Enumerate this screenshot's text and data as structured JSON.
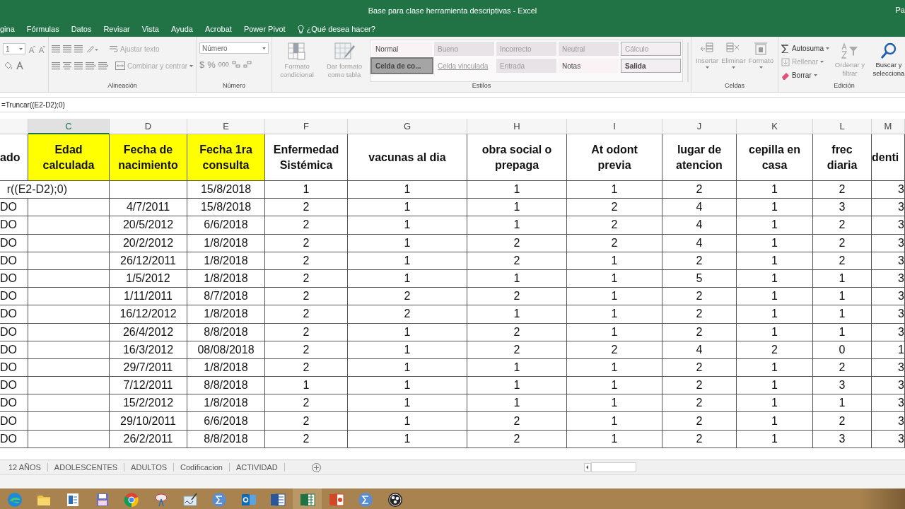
{
  "window": {
    "title": "Base para clase herramienta descriptivas  -  Excel",
    "account": "Pa"
  },
  "menu_tabs": [
    {
      "label": "gina",
      "kind": "tab",
      "selected": false
    },
    {
      "label": "Fórmulas",
      "kind": "tab",
      "selected": false
    },
    {
      "label": "Datos",
      "kind": "tab",
      "selected": false
    },
    {
      "label": "Revisar",
      "kind": "tab",
      "selected": false
    },
    {
      "label": "Vista",
      "kind": "tab",
      "selected": false
    },
    {
      "label": "Ayuda",
      "kind": "tab",
      "selected": false
    },
    {
      "label": "Acrobat",
      "kind": "tab",
      "selected": false
    },
    {
      "label": "Power Pivot",
      "kind": "tab",
      "selected": false
    },
    {
      "label": "¿Qué desea hacer?",
      "kind": "tell",
      "selected": false
    }
  ],
  "ribbon": {
    "font": {
      "size": "1"
    },
    "alignment": {
      "label": "Alineación",
      "wrap": {
        "label": "Ajustar texto",
        "disabled": true
      },
      "merge": {
        "label": "Combinar y centrar",
        "disabled": true
      }
    },
    "number": {
      "label": "Número",
      "format": "Número",
      "symbols": [
        "$",
        "%",
        "000"
      ]
    },
    "styles": {
      "label": "Estilos",
      "conditional": "Formato condicional",
      "table": "Dar formato como tabla",
      "gallery": [
        {
          "label": "Normal",
          "kind": "normal",
          "selected": false,
          "disabled": false
        },
        {
          "label": "Bueno",
          "kind": "plain",
          "selected": false,
          "disabled": true
        },
        {
          "label": "Incorrecto",
          "kind": "plain",
          "selected": false,
          "disabled": true
        },
        {
          "label": "Neutral",
          "kind": "plain",
          "selected": false,
          "disabled": true
        },
        {
          "label": "Cálculo",
          "kind": "boxed",
          "selected": false,
          "disabled": true
        },
        {
          "label": "Celda de co...",
          "kind": "check",
          "selected": true,
          "disabled": false
        },
        {
          "label": "Celda vinculada",
          "kind": "linked",
          "selected": false,
          "disabled": true
        },
        {
          "label": "Entrada",
          "kind": "plain",
          "selected": false,
          "disabled": true
        },
        {
          "label": "Notas",
          "kind": "normal",
          "selected": false,
          "disabled": false
        },
        {
          "label": "Salida",
          "kind": "boxed",
          "selected": false,
          "disabled": false
        }
      ]
    },
    "cells": {
      "label": "Celdas",
      "commands": [
        {
          "label": "Insertar",
          "kind": "insert",
          "disabled": true
        },
        {
          "label": "Eliminar",
          "kind": "delete",
          "disabled": true
        },
        {
          "label": "Formato",
          "kind": "format",
          "disabled": true
        }
      ]
    },
    "editing": {
      "label": "Edición",
      "commands": [
        {
          "label": "Autosuma",
          "kind": "sum",
          "disabled": false
        },
        {
          "label": "Rellenar",
          "kind": "fill",
          "disabled": true
        },
        {
          "label": "Borrar",
          "kind": "clear",
          "disabled": false
        }
      ],
      "sort": {
        "label": "Ordenar y filtrar",
        "disabled": true
      },
      "find": {
        "label": "Buscar y selecciona",
        "disabled": false
      }
    }
  },
  "formula_bar": {
    "formula": "=Truncar((E2-D2);0)"
  },
  "sheet": {
    "columns": [
      {
        "heading": "ado",
        "selected": false,
        "highlighted": false
      },
      {
        "letter": "C",
        "heading": "Edad calculada",
        "selected": true,
        "highlighted": true
      },
      {
        "letter": "D",
        "heading": "Fecha de nacimiento",
        "selected": false,
        "highlighted": true
      },
      {
        "letter": "E",
        "heading": "Fecha 1ra consulta",
        "selected": false,
        "highlighted": true
      },
      {
        "letter": "F",
        "heading": "Enfermedad Sistémica",
        "selected": false,
        "highlighted": false
      },
      {
        "letter": "G",
        "heading": "vacunas al dia",
        "selected": false,
        "highlighted": false
      },
      {
        "letter": "H",
        "heading": "obra social o prepaga",
        "selected": false,
        "highlighted": false
      },
      {
        "letter": "I",
        "heading": "At odont previa",
        "selected": false,
        "highlighted": false
      },
      {
        "letter": "J",
        "heading": "lugar de atencion",
        "selected": false,
        "highlighted": false
      },
      {
        "letter": "K",
        "heading": "cepilla en casa",
        "selected": false,
        "highlighted": false
      },
      {
        "letter": "L",
        "heading": "frec diaria",
        "selected": false,
        "highlighted": false
      },
      {
        "letter": "M",
        "heading": "denti",
        "selected": false,
        "highlighted": false
      }
    ],
    "rows": [
      {
        "editing": true,
        "cells": [
          null,
          "r((E2-D2);0)",
          null,
          "15/8/2018",
          "1",
          "1",
          "1",
          "1",
          "2",
          "1",
          "2",
          "3"
        ]
      },
      {
        "editing": false,
        "cells": [
          "DO",
          null,
          "4/7/2011",
          "15/8/2018",
          "2",
          "1",
          "1",
          "2",
          "4",
          "1",
          "3",
          "3"
        ]
      },
      {
        "editing": false,
        "cells": [
          "DO",
          null,
          "20/5/2012",
          "6/6/2018",
          "2",
          "1",
          "1",
          "2",
          "4",
          "1",
          "2",
          "3"
        ]
      },
      {
        "editing": false,
        "cells": [
          "DO",
          null,
          "20/2/2012",
          "1/8/2018",
          "2",
          "1",
          "2",
          "2",
          "4",
          "1",
          "2",
          "3"
        ]
      },
      {
        "editing": false,
        "cells": [
          "DO",
          null,
          "26/12/2011",
          "1/8/2018",
          "2",
          "1",
          "2",
          "1",
          "2",
          "1",
          "2",
          "3"
        ]
      },
      {
        "editing": false,
        "cells": [
          "DO",
          null,
          "1/5/2012",
          "1/8/2018",
          "2",
          "1",
          "1",
          "1",
          "5",
          "1",
          "1",
          "3"
        ]
      },
      {
        "editing": false,
        "cells": [
          "DO",
          null,
          "1/11/2011",
          "8/7/2018",
          "2",
          "2",
          "2",
          "1",
          "2",
          "1",
          "1",
          "3"
        ]
      },
      {
        "editing": false,
        "cells": [
          "DO",
          null,
          "16/12/2012",
          "1/8/2018",
          "2",
          "2",
          "1",
          "1",
          "2",
          "1",
          "1",
          "3"
        ]
      },
      {
        "editing": false,
        "cells": [
          "DO",
          null,
          "26/4/2012",
          "8/8/2018",
          "2",
          "1",
          "2",
          "1",
          "2",
          "1",
          "1",
          "3"
        ]
      },
      {
        "editing": false,
        "cells": [
          "DO",
          null,
          "16/3/2012",
          "08/08/2018",
          "2",
          "1",
          "2",
          "2",
          "4",
          "2",
          "0",
          "1"
        ]
      },
      {
        "editing": false,
        "cells": [
          "DO",
          null,
          "29/7/2011",
          "1/8/2018",
          "2",
          "1",
          "1",
          "1",
          "2",
          "1",
          "2",
          "3"
        ]
      },
      {
        "editing": false,
        "cells": [
          "DO",
          null,
          "7/12/2011",
          "8/8/2018",
          "1",
          "1",
          "1",
          "1",
          "2",
          "1",
          "3",
          "3"
        ]
      },
      {
        "editing": false,
        "cells": [
          "DO",
          null,
          "15/2/2012",
          "1/8/2018",
          "2",
          "1",
          "1",
          "1",
          "2",
          "1",
          "1",
          "3"
        ]
      },
      {
        "editing": false,
        "cells": [
          "DO",
          null,
          "29/10/2011",
          "6/6/2018",
          "2",
          "1",
          "2",
          "1",
          "2",
          "1",
          "2",
          "3"
        ]
      },
      {
        "editing": false,
        "cells": [
          "DO",
          null,
          "26/2/2011",
          "8/8/2018",
          "2",
          "1",
          "2",
          "1",
          "2",
          "1",
          "3",
          "3"
        ]
      }
    ]
  },
  "sheet_tabs": [
    {
      "label": "12 AÑOS",
      "selected": false
    },
    {
      "label": "ADOLESCENTES",
      "selected": false
    },
    {
      "label": "ADULTOS",
      "selected": false
    },
    {
      "label": "Codificacion",
      "selected": false
    },
    {
      "label": "ACTIVIDAD",
      "selected": false
    }
  ],
  "taskbar": [
    {
      "kind": "edge",
      "selected": false
    },
    {
      "kind": "folder",
      "selected": false
    },
    {
      "kind": "doc",
      "selected": false
    },
    {
      "kind": "save",
      "selected": false
    },
    {
      "kind": "chrome",
      "selected": false
    },
    {
      "kind": "tool",
      "selected": false
    },
    {
      "kind": "sign",
      "selected": false
    },
    {
      "kind": "calc",
      "selected": false
    },
    {
      "kind": "outlook",
      "selected": false
    },
    {
      "kind": "word",
      "selected": false
    },
    {
      "kind": "excel",
      "selected": true
    },
    {
      "kind": "powerpoint",
      "selected": false
    },
    {
      "kind": "calc",
      "selected": false
    },
    {
      "kind": "obs",
      "selected": false
    }
  ]
}
